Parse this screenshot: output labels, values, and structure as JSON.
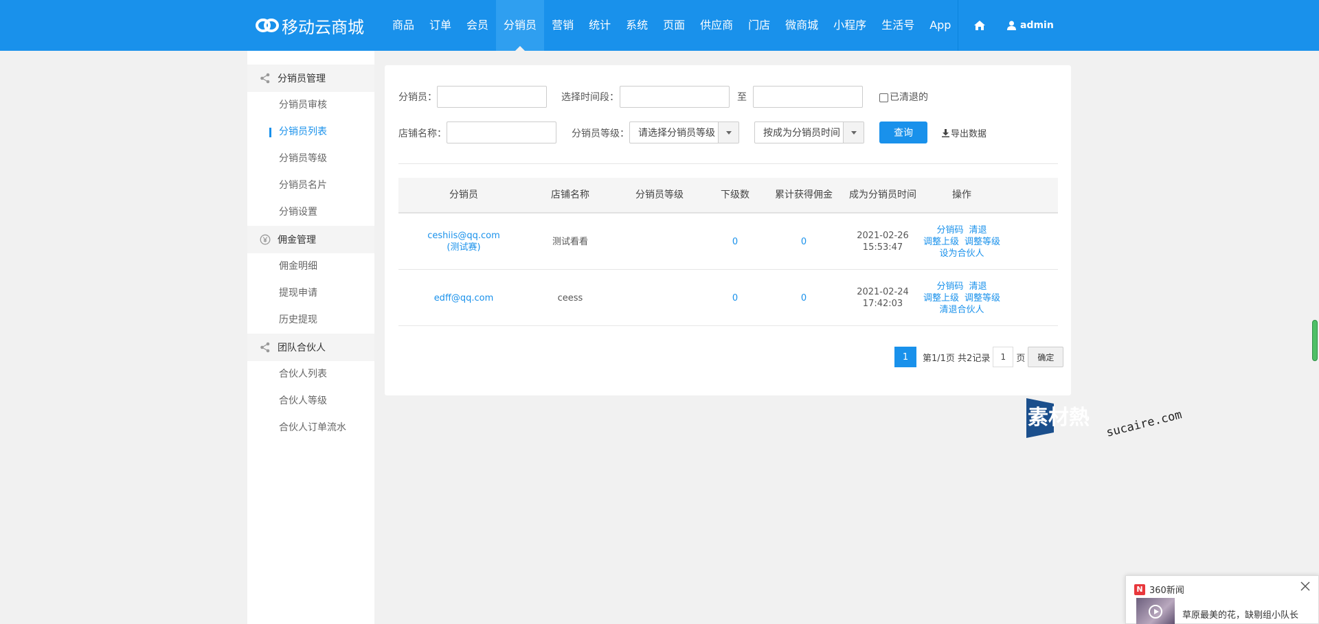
{
  "header": {
    "logo_text": "移动云商城",
    "nav": [
      "商品",
      "订单",
      "会员",
      "分销员",
      "营销",
      "统计",
      "系统",
      "页面",
      "供应商",
      "门店",
      "微商城",
      "小程序",
      "生活号",
      "App"
    ],
    "active_nav_index": 3,
    "user": "admin"
  },
  "sidebar": {
    "groups": [
      {
        "title": "分销员管理",
        "icon": "share-icon",
        "items": [
          "分销员审核",
          "分销员列表",
          "分销员等级",
          "分销员名片",
          "分销设置"
        ]
      },
      {
        "title": "佣金管理",
        "icon": "yen-icon",
        "items": [
          "佣金明细",
          "提现申请",
          "历史提现"
        ]
      },
      {
        "title": "团队合伙人",
        "icon": "share-icon",
        "items": [
          "合伙人列表",
          "合伙人等级",
          "合伙人订单流水"
        ]
      }
    ],
    "active_item": "分销员列表"
  },
  "filters": {
    "distributor_label": "分销员：",
    "time_label": "选择时间段：",
    "to_label": "至",
    "cleared_label": "已清退的",
    "cleared_checked": false,
    "store_label": "店铺名称：",
    "level_label": "分销员等级：",
    "level_select": "请选择分销员等级",
    "sort_select": "按成为分销员时间",
    "query_button": "查询",
    "export_button": "导出数据"
  },
  "table": {
    "columns": [
      "分销员",
      "店铺名称",
      "分销员等级",
      "下级数",
      "累计获得佣金",
      "成为分销员时间",
      "操作"
    ],
    "rows": [
      {
        "distributor": "ceshiis@qq.com",
        "distributor_sub": "(测试赛)",
        "store": "测试看看",
        "level": "",
        "sub_count": "0",
        "commission": "0",
        "date": "2021-02-26",
        "time": "15:53:47",
        "ops": [
          "分销码",
          "清退",
          "调整上级",
          "调整等级",
          "设为合伙人"
        ]
      },
      {
        "distributor": "edff@qq.com",
        "distributor_sub": "",
        "store": "ceess",
        "level": "",
        "sub_count": "0",
        "commission": "0",
        "date": "2021-02-24",
        "time": "17:42:03",
        "ops": [
          "分销码",
          "清退",
          "调整上级",
          "调整等级",
          "清退合伙人"
        ]
      }
    ]
  },
  "pagination": {
    "current": "1",
    "info": "第1/1页 共2记录",
    "input": "1",
    "unit": "页",
    "confirm": "确定"
  },
  "watermark": {
    "brand": "素材熱",
    "domain": "sucaire.com"
  },
  "news_popup": {
    "source": "360新闻",
    "logo": "N",
    "headline": "草原最美的花，缺剔组小队长"
  },
  "colors": {
    "primary": "#1991eb",
    "nav_active": "#2f9ff0",
    "page_bg": "#f1f1f1"
  }
}
